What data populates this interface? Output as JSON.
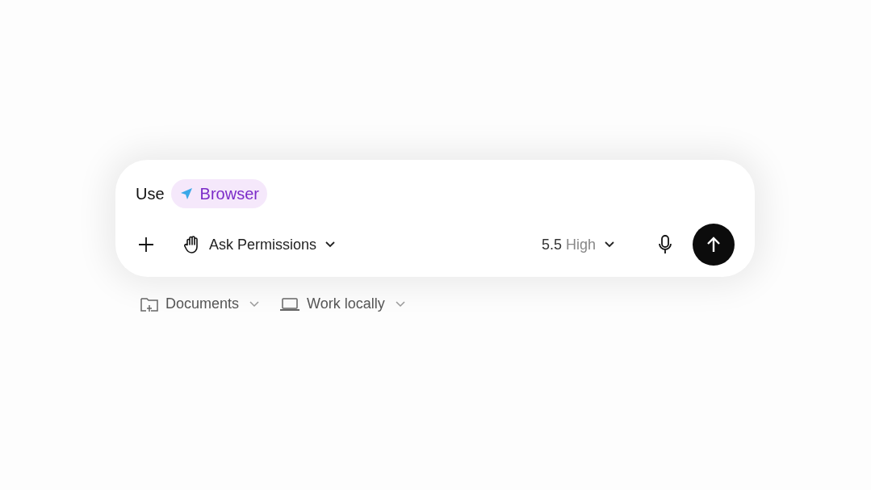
{
  "composer": {
    "prefix": "Use",
    "tool_chip": {
      "label": "Browser"
    },
    "permissions": {
      "label": "Ask Permissions"
    },
    "model": {
      "version": "5.5",
      "effort": "High"
    }
  },
  "context": [
    {
      "kind": "folder",
      "label": "Documents"
    },
    {
      "kind": "laptop",
      "label": "Work locally"
    }
  ]
}
